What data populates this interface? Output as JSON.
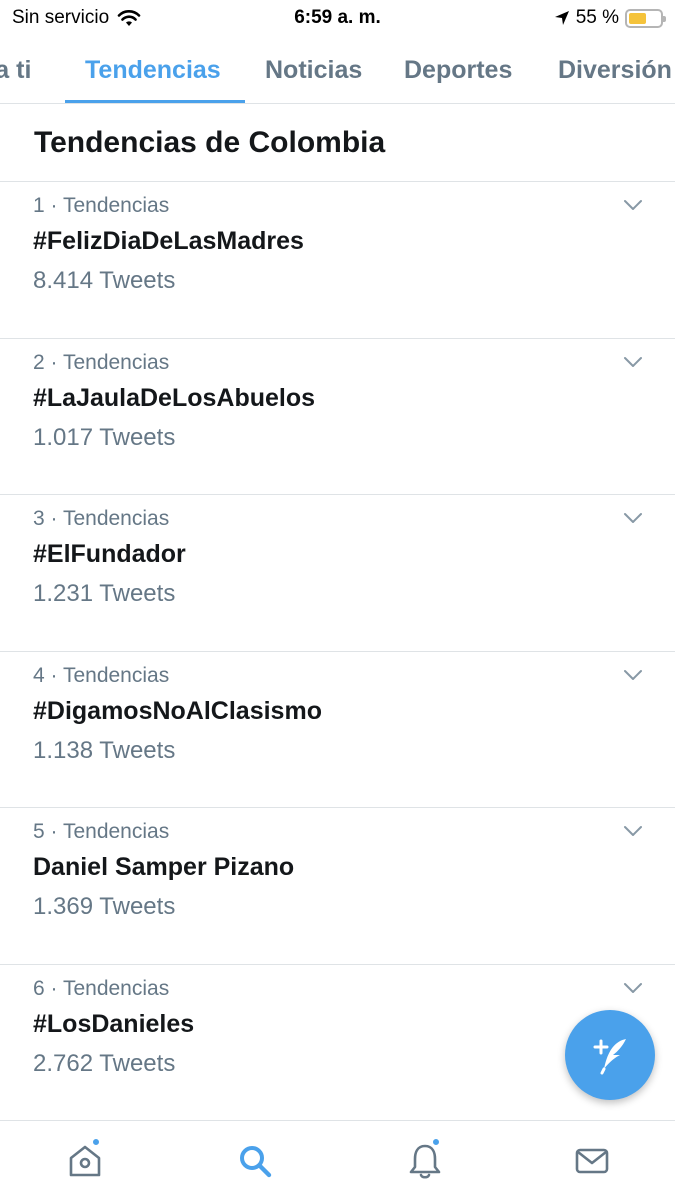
{
  "status_bar": {
    "carrier": "Sin servicio",
    "time": "6:59 a. m.",
    "battery": "55 %",
    "battery_level": 0.55
  },
  "tabs": [
    {
      "label": "Para ti",
      "active": false
    },
    {
      "label": "Tendencias",
      "active": true
    },
    {
      "label": "Noticias",
      "active": false
    },
    {
      "label": "Deportes",
      "active": false
    },
    {
      "label": "Diversión",
      "active": false
    }
  ],
  "section_title": "Tendencias de Colombia",
  "trends": [
    {
      "meta": "1 · Tendencias",
      "name": "#FelizDiaDeLasMadres",
      "count": "8.414 Tweets"
    },
    {
      "meta": "2 · Tendencias",
      "name": "#LaJaulaDeLosAbuelos",
      "count": "1.017 Tweets"
    },
    {
      "meta": "3 · Tendencias",
      "name": "#ElFundador",
      "count": "1.231 Tweets"
    },
    {
      "meta": "4 · Tendencias",
      "name": "#DigamosNoAlClasismo",
      "count": "1.138 Tweets"
    },
    {
      "meta": "5 · Tendencias",
      "name": "Daniel Samper Pizano",
      "count": "1.369 Tweets"
    },
    {
      "meta": "6 · Tendencias",
      "name": "#LosDanieles",
      "count": "2.762 Tweets"
    }
  ],
  "colors": {
    "accent": "#4aa1eb",
    "text_primary": "#14171a",
    "text_secondary": "#657786",
    "divider": "#dfe3e6",
    "battery": "#f5c33b"
  },
  "icons": {
    "compose": "compose-tweet-icon",
    "nav": [
      "home-icon",
      "search-icon",
      "notifications-icon",
      "messages-icon"
    ]
  }
}
